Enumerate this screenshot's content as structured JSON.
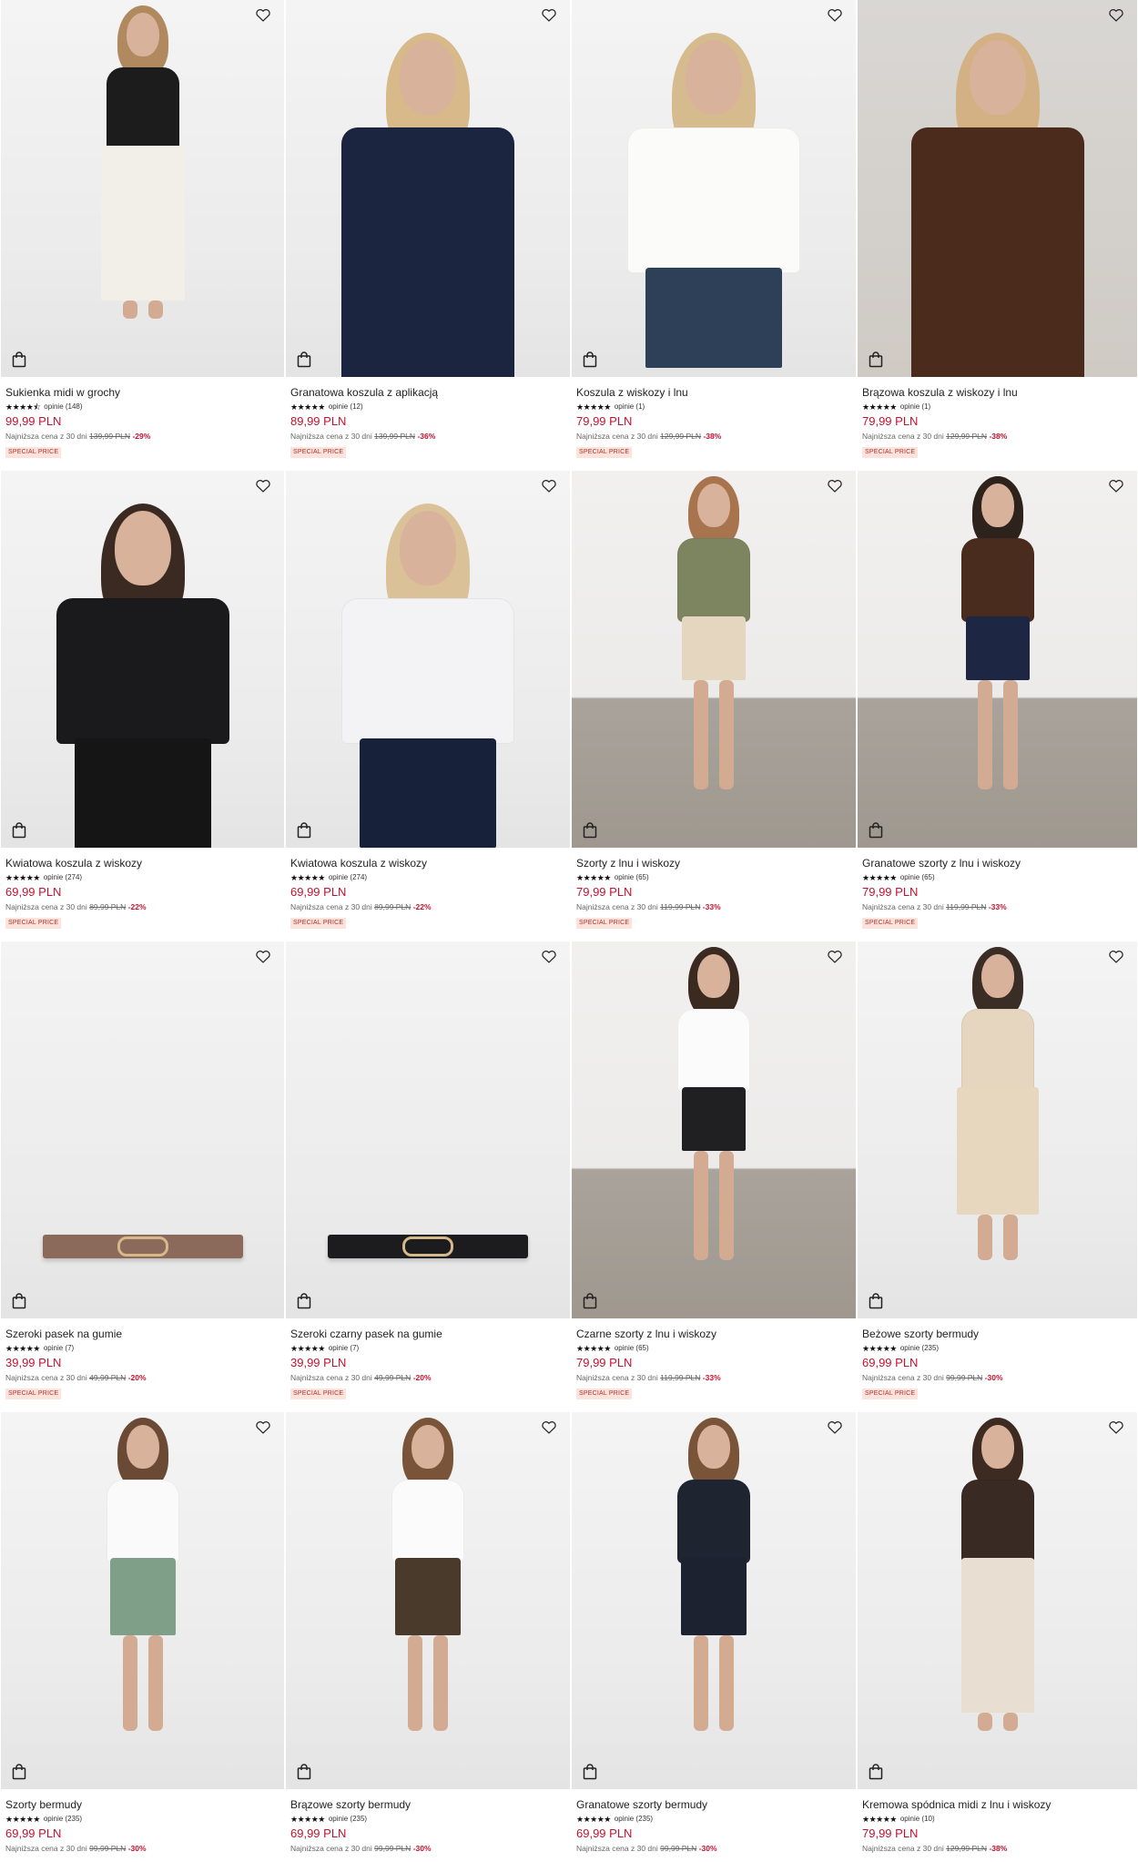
{
  "labels": {
    "lowest_prefix": "Najniższa cena z 30 dni",
    "currency": "PLN",
    "special_price": "SPECIAL PRICE",
    "reviews_word": "opinie"
  },
  "colors": {
    "price": "#c4122f",
    "badge_bg": "#fde3dc",
    "badge_text": "#b0302a"
  },
  "icons": {
    "favorite": "heart-icon",
    "bag": "shopping-bag-icon",
    "rating": "star-icon"
  },
  "products": [
    {
      "name": "Sukienka midi w grochy",
      "stars": "★★★★⯪",
      "reviews": "opinie (148)",
      "price": "99,99 PLN",
      "lowest": "Najniższa cena z 30 dni",
      "old_price": "139,99 PLN",
      "discount": "-29%",
      "badge": "SPECIAL PRICE",
      "look": "dress-dots"
    },
    {
      "name": "Granatowa koszula z aplikacją",
      "stars": "★★★★★",
      "reviews": "opinie (12)",
      "price": "89,99 PLN",
      "lowest": "Najniższa cena z 30 dni",
      "old_price": "139,99 PLN",
      "discount": "-36%",
      "badge": "SPECIAL PRICE",
      "look": "navy-shirt"
    },
    {
      "name": "Koszula z wiskozy i lnu",
      "stars": "★★★★★",
      "reviews": "opinie (1)",
      "price": "79,99 PLN",
      "lowest": "Najniższa cena z 30 dni",
      "old_price": "129,99 PLN",
      "discount": "-38%",
      "badge": "SPECIAL PRICE",
      "look": "white-shirt"
    },
    {
      "name": "Brązowa koszula z wiskozy i lnu",
      "stars": "★★★★★",
      "reviews": "opinie (1)",
      "price": "79,99 PLN",
      "lowest": "Najniższa cena z 30 dni",
      "old_price": "129,99 PLN",
      "discount": "-38%",
      "badge": "SPECIAL PRICE",
      "look": "brown-shirt"
    },
    {
      "name": "Kwiatowa koszula z wiskozy",
      "stars": "★★★★★",
      "reviews": "opinie (274)",
      "price": "69,99 PLN",
      "lowest": "Najniższa cena z 30 dni",
      "old_price": "89,99 PLN",
      "discount": "-22%",
      "badge": "SPECIAL PRICE",
      "look": "floral-black"
    },
    {
      "name": "Kwiatowa koszula z wiskozy",
      "stars": "★★★★★",
      "reviews": "opinie (274)",
      "price": "69,99 PLN",
      "lowest": "Najniższa cena z 30 dni",
      "old_price": "89,99 PLN",
      "discount": "-22%",
      "badge": "SPECIAL PRICE",
      "look": "floral-white"
    },
    {
      "name": "Szorty z lnu i wiskozy",
      "stars": "★★★★★",
      "reviews": "opinie (65)",
      "price": "79,99 PLN",
      "lowest": "Najniższa cena z 30 dni",
      "old_price": "119,99 PLN",
      "discount": "-33%",
      "badge": "SPECIAL PRICE",
      "look": "beige-shorts"
    },
    {
      "name": "Granatowe szorty z lnu i wiskozy",
      "stars": "★★★★★",
      "reviews": "opinie (65)",
      "price": "79,99 PLN",
      "lowest": "Najniższa cena z 30 dni",
      "old_price": "119,99 PLN",
      "discount": "-33%",
      "badge": "SPECIAL PRICE",
      "look": "navy-shorts"
    },
    {
      "name": "Szeroki pasek na gumie",
      "stars": "★★★★★",
      "reviews": "opinie (7)",
      "price": "39,99 PLN",
      "lowest": "Najniższa cena z 30 dni",
      "old_price": "49,99 PLN",
      "discount": "-20%",
      "badge": "SPECIAL PRICE",
      "look": "belt-brown"
    },
    {
      "name": "Szeroki czarny pasek na gumie",
      "stars": "★★★★★",
      "reviews": "opinie (7)",
      "price": "39,99 PLN",
      "lowest": "Najniższa cena z 30 dni",
      "old_price": "49,99 PLN",
      "discount": "-20%",
      "badge": "SPECIAL PRICE",
      "look": "belt-black"
    },
    {
      "name": "Czarne szorty z lnu i wiskozy",
      "stars": "★★★★★",
      "reviews": "opinie (65)",
      "price": "79,99 PLN",
      "lowest": "Najniższa cena z 30 dni",
      "old_price": "119,99 PLN",
      "discount": "-33%",
      "badge": "SPECIAL PRICE",
      "look": "black-shorts"
    },
    {
      "name": "Beżowe szorty bermudy",
      "stars": "★★★★★",
      "reviews": "opinie (235)",
      "price": "69,99 PLN",
      "lowest": "Najniższa cena z 30 dni",
      "old_price": "99,99 PLN",
      "discount": "-30%",
      "badge": "SPECIAL PRICE",
      "look": "beige-bermuda"
    },
    {
      "name": "Szorty bermudy",
      "stars": "★★★★★",
      "reviews": "opinie (235)",
      "price": "69,99 PLN",
      "lowest": "Najniższa cena z 30 dni",
      "old_price": "99,99 PLN",
      "discount": "-30%",
      "badge": "",
      "look": "green-bermuda"
    },
    {
      "name": "Brązowe szorty bermudy",
      "stars": "★★★★★",
      "reviews": "opinie (235)",
      "price": "69,99 PLN",
      "lowest": "Najniższa cena z 30 dni",
      "old_price": "99,99 PLN",
      "discount": "-30%",
      "badge": "",
      "look": "brown-bermuda"
    },
    {
      "name": "Granatowe szorty bermudy",
      "stars": "★★★★★",
      "reviews": "opinie (235)",
      "price": "69,99 PLN",
      "lowest": "Najniższa cena z 30 dni",
      "old_price": "99,99 PLN",
      "discount": "-30%",
      "badge": "",
      "look": "navy-bermuda"
    },
    {
      "name": "Kremowa spódnica midi z lnu i wiskozy",
      "stars": "★★★★★",
      "reviews": "opinie (10)",
      "price": "79,99 PLN",
      "lowest": "Najniższa cena z 30 dni",
      "old_price": "129,99 PLN",
      "discount": "-38%",
      "badge": "",
      "look": "cream-skirt"
    }
  ]
}
